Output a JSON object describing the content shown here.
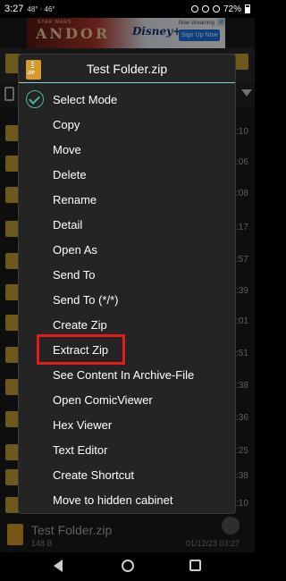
{
  "status_bar": {
    "time": "3:27",
    "left_stats": "48° ⋅ 46°",
    "battery": "72%"
  },
  "ad": {
    "brand": "ANDOR",
    "franchise": "STAR WARS",
    "disney": "Disney+",
    "streaming": "Now streaming",
    "cta": "Sign Up Now"
  },
  "background_list": {
    "times": [
      ":10",
      ":06",
      ":08",
      ":17",
      ":57",
      ":39",
      ":01",
      ":51",
      ":38",
      ":36",
      ":25",
      ":38",
      ":10"
    ],
    "bottom_file": {
      "name": "Test Folder.zip",
      "size": "148 B",
      "date": "01/12/23 03:27"
    }
  },
  "dialog": {
    "title": "Test Folder.zip",
    "zip_icon_label": "ZIP",
    "items": [
      {
        "label": "Select Mode"
      },
      {
        "label": "Copy"
      },
      {
        "label": "Move"
      },
      {
        "label": "Delete"
      },
      {
        "label": "Rename"
      },
      {
        "label": "Detail"
      },
      {
        "label": "Open As"
      },
      {
        "label": "Send To"
      },
      {
        "label": "Send To (*/*)"
      },
      {
        "label": "Create Zip"
      },
      {
        "label": "Extract Zip"
      },
      {
        "label": "See Content In Archive-File"
      },
      {
        "label": "Open ComicViewer"
      },
      {
        "label": "Hex Viewer"
      },
      {
        "label": "Text Editor"
      },
      {
        "label": "Create Shortcut"
      },
      {
        "label": "Move to hidden cabinet"
      }
    ]
  },
  "colors": {
    "accent": "#47b89e",
    "divider": "#7fd4cf",
    "highlight": "#e31b1b",
    "folder": "#c8a236"
  }
}
